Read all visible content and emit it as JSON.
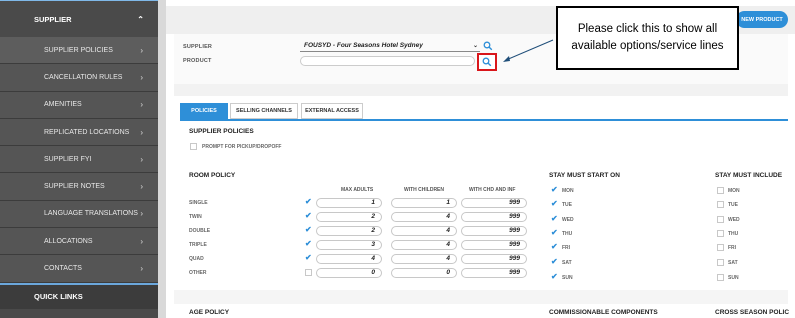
{
  "sidebar": {
    "header": "SUPPLIER",
    "items": [
      {
        "label": "SUPPLIER POLICIES"
      },
      {
        "label": "CANCELLATION RULES"
      },
      {
        "label": "AMENITIES"
      },
      {
        "label": "REPLICATED LOCATIONS"
      },
      {
        "label": "SUPPLIER FYI"
      },
      {
        "label": "SUPPLIER NOTES"
      },
      {
        "label": "LANGUAGE TRANSLATIONS"
      },
      {
        "label": "ALLOCATIONS"
      },
      {
        "label": "CONTACTS"
      }
    ],
    "quick_links": "QUICK LINKS"
  },
  "header": {
    "new_product": "NEW PRODUCT"
  },
  "form": {
    "supplier_label": "SUPPLIER",
    "supplier_value": "FOUSYD - Four Seasons Hotel Sydney",
    "product_label": "PRODUCT"
  },
  "callout": {
    "text": "Please click this to show all available options/service lines"
  },
  "tabs": [
    {
      "label": "POLICIES",
      "active": true
    },
    {
      "label": "SELLING CHANNELS",
      "active": false
    },
    {
      "label": "EXTERNAL ACCESS",
      "active": false
    }
  ],
  "supplier_policies": {
    "title": "SUPPLIER POLICIES",
    "prompt_label": "PROMPT FOR PICKUP/DROPOFF"
  },
  "room_policy": {
    "title": "ROOM POLICY",
    "columns": [
      "MAX ADULTS",
      "WITH CHILDREN",
      "WITH CHD AND INF"
    ],
    "rows": [
      {
        "label": "SINGLE",
        "checked": true,
        "values": [
          "1",
          "1",
          "999"
        ]
      },
      {
        "label": "TWIN",
        "checked": true,
        "values": [
          "2",
          "4",
          "999"
        ]
      },
      {
        "label": "DOUBLE",
        "checked": true,
        "values": [
          "2",
          "4",
          "999"
        ]
      },
      {
        "label": "TRIPLE",
        "checked": true,
        "values": [
          "3",
          "4",
          "999"
        ]
      },
      {
        "label": "QUAD",
        "checked": true,
        "values": [
          "4",
          "4",
          "999"
        ]
      },
      {
        "label": "OTHER",
        "checked": false,
        "values": [
          "0",
          "0",
          "999"
        ]
      }
    ]
  },
  "stay_must_start": {
    "title": "STAY MUST START ON",
    "days": [
      "MON",
      "TUE",
      "WED",
      "THU",
      "FRI",
      "SAT",
      "SUN"
    ]
  },
  "stay_must_include": {
    "title": "STAY MUST INCLUDE",
    "days": [
      "MON",
      "TUE",
      "WED",
      "THU",
      "FRI",
      "SAT",
      "SUN"
    ]
  },
  "bottom": {
    "age_policy": "AGE POLICY",
    "commissionable": "COMMISSIONABLE COMPONENTS",
    "cross_season": "CROSS SEASON POLIC"
  },
  "colors": {
    "accent": "#2e8fd8",
    "highlight": "#d9161b",
    "sidebar": "#4a4a4a"
  }
}
